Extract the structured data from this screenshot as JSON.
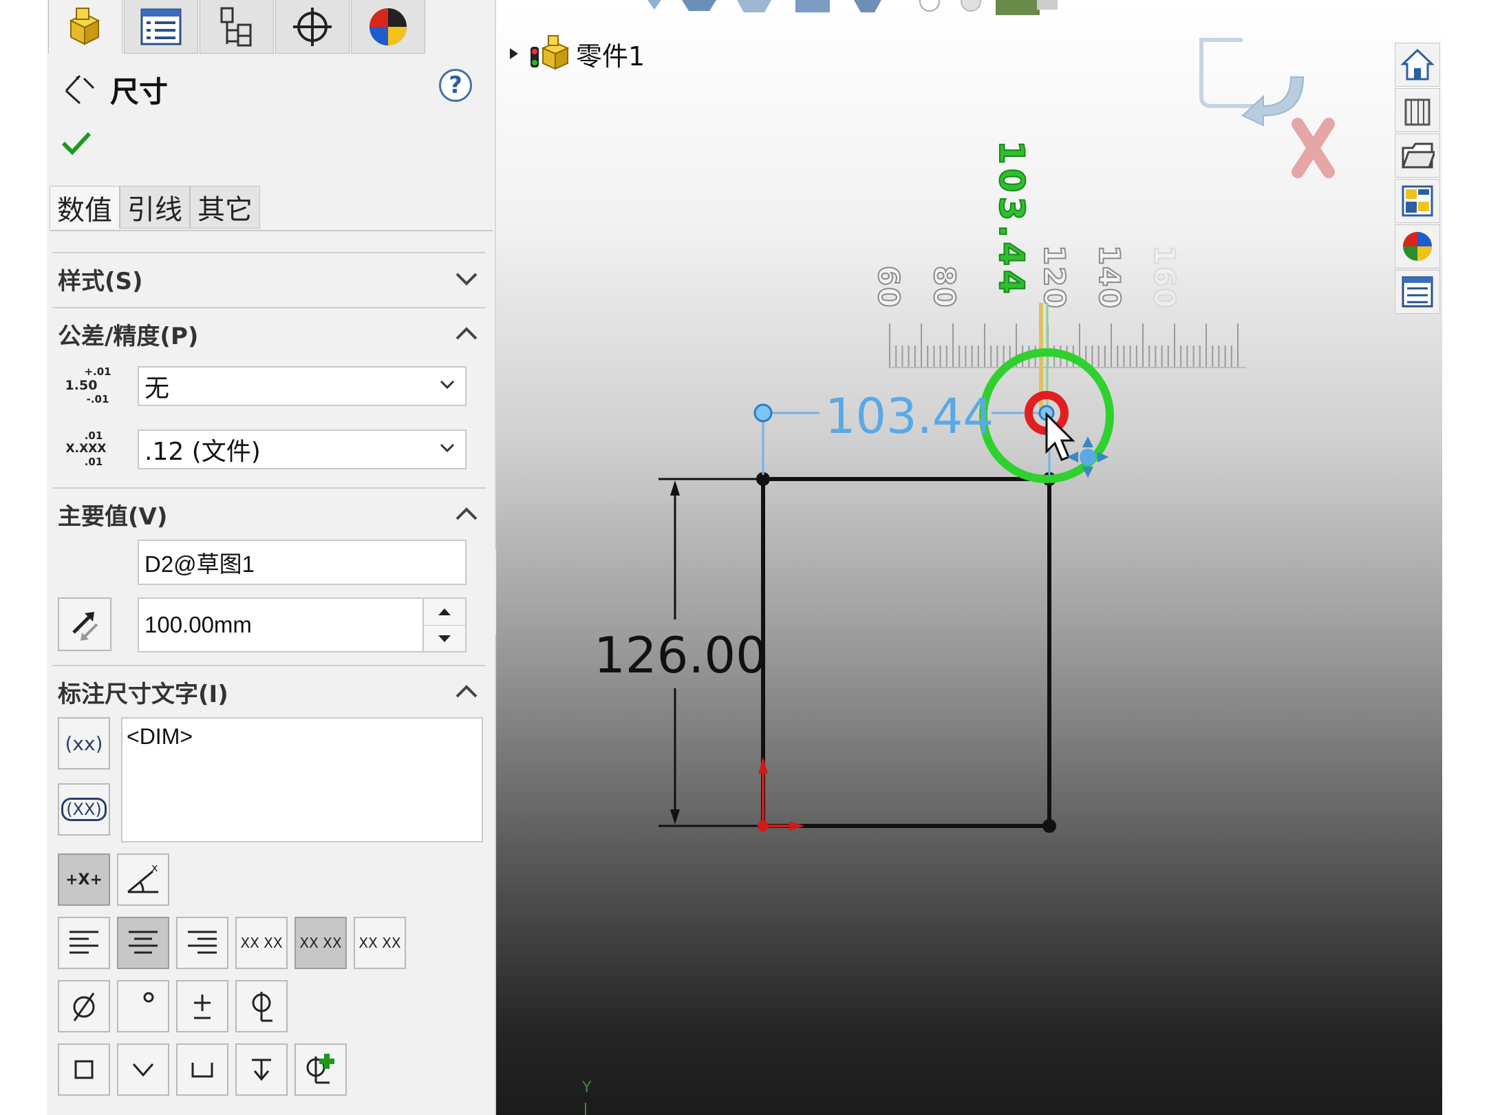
{
  "property_manager": {
    "title": "尺寸",
    "help_symbol": "?",
    "tabs": [
      "数值",
      "引线",
      "其它"
    ],
    "groups": {
      "style": "样式(S)",
      "tolerance": "公差/精度(P)",
      "primary_value": "主要值(V)",
      "dimension_text": "标注尺寸文字(I)"
    },
    "tolerance_type": "无",
    "precision": ".12 (文件)",
    "tolerance_icon_text": {
      "top": "+.01",
      "mid": "1.50",
      "bot": "-.01"
    },
    "precision_icon_text": {
      "top": ".01",
      "mid": "X.XXX",
      "bot": ".01"
    },
    "dimension_name": "D2@草图1",
    "dimension_value": "100.00mm",
    "dim_text_content": "<DIM>",
    "paren_btn_text": "(xx)",
    "box_btn_text": "(XX)",
    "dim_symbol_text": "+X+",
    "justify_labels": [
      "XX XX",
      "XX XX",
      "XX XX"
    ]
  },
  "feature_tree": {
    "root_label": "零件1"
  },
  "viewport": {
    "vertical_dim": "126.00",
    "horizontal_dim": "103.44",
    "ruler_readout": "103.44",
    "ruler_ticks": [
      "60",
      "80",
      "120",
      "140",
      "160"
    ],
    "axis_label": "Y"
  },
  "colors": {
    "accent_green": "#1f9e1f",
    "dim_blue": "#5aa9e6",
    "error_red": "#d11b1b"
  }
}
